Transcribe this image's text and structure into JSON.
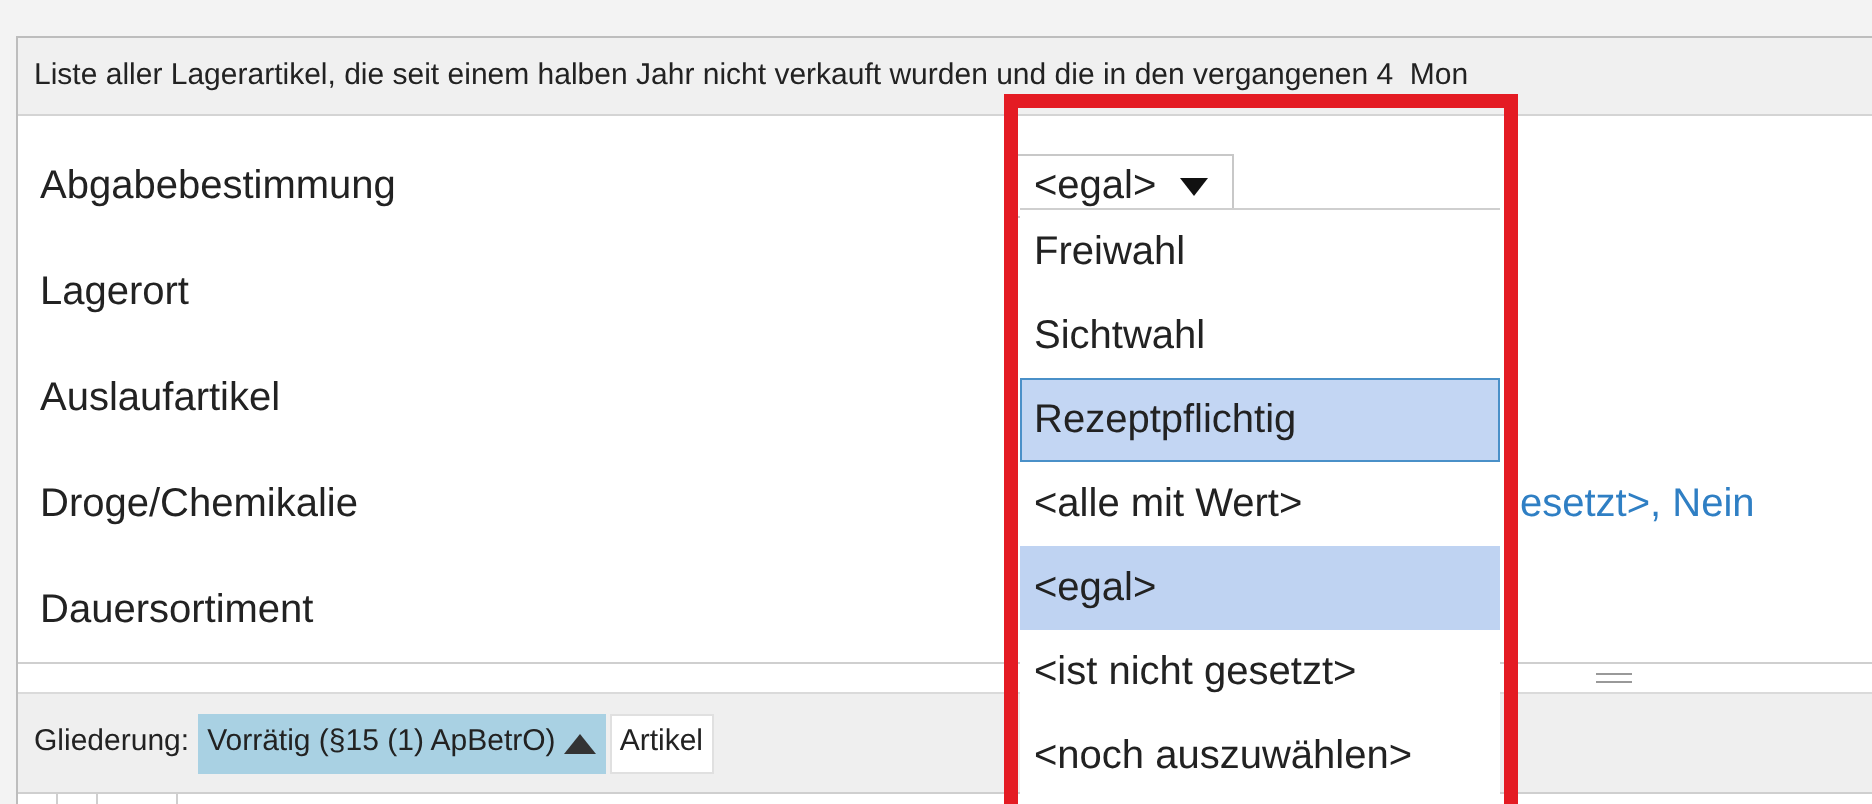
{
  "description": "Liste aller Lagerartikel, die seit einem halben Jahr nicht verkauft wurden und die in den vergangenen 4  Mon",
  "fields": [
    {
      "label": "Abgabebestimmung",
      "kind": "combo",
      "value": "<egal>",
      "expanded": true
    },
    {
      "label": "Lagerort",
      "kind": "empty"
    },
    {
      "label": "Auslaufartikel",
      "kind": "empty"
    },
    {
      "label": "Droge/Chemikalie",
      "kind": "text",
      "value": "esetzt>, Nein"
    },
    {
      "label": "Dauersortiment",
      "kind": "empty"
    }
  ],
  "dropdown_options": [
    {
      "label": "Freiwahl",
      "selected": false,
      "highlighted": false
    },
    {
      "label": "Sichtwahl",
      "selected": false,
      "highlighted": false
    },
    {
      "label": "Rezeptpflichtig",
      "selected": false,
      "highlighted": true
    },
    {
      "label": "<alle mit Wert>",
      "selected": false,
      "highlighted": false
    },
    {
      "label": "<egal>",
      "selected": true,
      "highlighted": false
    },
    {
      "label": "<ist nicht gesetzt>",
      "selected": false,
      "highlighted": false
    },
    {
      "label": "<noch auszuwählen>",
      "selected": false,
      "highlighted": false
    }
  ],
  "grouping": {
    "label": "Gliederung:",
    "chips": [
      {
        "label": "Vorrätig (§15 (1) ApBetrO)",
        "selected": true,
        "sort_ascending": true
      },
      {
        "label": "Artikel",
        "selected": false
      }
    ]
  }
}
